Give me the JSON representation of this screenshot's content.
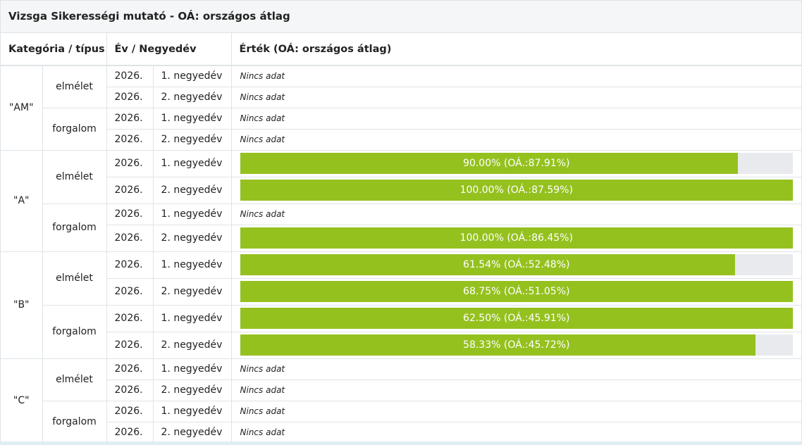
{
  "panel": {
    "title": "Vizsga Sikerességi mutató - OÁ: országos átlag"
  },
  "table": {
    "headers": {
      "category": "Kategória / típus",
      "period": "Év / Negyedév",
      "value": "Érték (OÁ: országos átlag)"
    },
    "no_data": "Nincs adat",
    "categories": [
      {
        "name": "\"AM\"",
        "types": [
          {
            "name": "elmélet",
            "rows": [
              {
                "year": "2026.",
                "quarter": "1. negyedév",
                "text": "Nincs adat",
                "has_bar": false
              },
              {
                "year": "2026.",
                "quarter": "2. negyedév",
                "text": "Nincs adat",
                "has_bar": false
              }
            ]
          },
          {
            "name": "forgalom",
            "rows": [
              {
                "year": "2026.",
                "quarter": "1. negyedév",
                "text": "Nincs adat",
                "has_bar": false
              },
              {
                "year": "2026.",
                "quarter": "2. negyedév",
                "text": "Nincs adat",
                "has_bar": false
              }
            ]
          }
        ]
      },
      {
        "name": "\"A\"",
        "types": [
          {
            "name": "elmélet",
            "rows": [
              {
                "year": "2026.",
                "quarter": "1. negyedév",
                "text": "90.00% (OÁ.:87.91%)",
                "has_bar": true,
                "value": 90.0
              },
              {
                "year": "2026.",
                "quarter": "2. negyedév",
                "text": "100.00% (OÁ.:87.59%)",
                "has_bar": true,
                "value": 100.0
              }
            ]
          },
          {
            "name": "forgalom",
            "rows": [
              {
                "year": "2026.",
                "quarter": "1. negyedév",
                "text": "Nincs adat",
                "has_bar": false
              },
              {
                "year": "2026.",
                "quarter": "2. negyedév",
                "text": "100.00% (OÁ.:86.45%)",
                "has_bar": true,
                "value": 100.0
              }
            ]
          }
        ]
      },
      {
        "name": "\"B\"",
        "types": [
          {
            "name": "elmélet",
            "rows": [
              {
                "year": "2026.",
                "quarter": "1. negyedév",
                "text": "61.54% (OÁ.:52.48%)",
                "has_bar": true,
                "value": 89.5
              },
              {
                "year": "2026.",
                "quarter": "2. negyedév",
                "text": "68.75% (OÁ.:51.05%)",
                "has_bar": true,
                "value": 100.0
              }
            ]
          },
          {
            "name": "forgalom",
            "rows": [
              {
                "year": "2026.",
                "quarter": "1. negyedév",
                "text": "62.50% (OÁ.:45.91%)",
                "has_bar": true,
                "value": 100.0
              },
              {
                "year": "2026.",
                "quarter": "2. negyedév",
                "text": "58.33% (OÁ.:45.72%)",
                "has_bar": true,
                "value": 93.3
              }
            ]
          }
        ]
      },
      {
        "name": "\"C\"",
        "types": [
          {
            "name": "elmélet",
            "rows": [
              {
                "year": "2026.",
                "quarter": "1. negyedév",
                "text": "Nincs adat",
                "has_bar": false
              },
              {
                "year": "2026.",
                "quarter": "2. negyedév",
                "text": "Nincs adat",
                "has_bar": false
              }
            ]
          },
          {
            "name": "forgalom",
            "rows": [
              {
                "year": "2026.",
                "quarter": "1. negyedév",
                "text": "Nincs adat",
                "has_bar": false
              },
              {
                "year": "2026.",
                "quarter": "2. negyedév",
                "text": "Nincs adat",
                "has_bar": false
              }
            ]
          }
        ]
      }
    ]
  },
  "colors": {
    "bar_fill": "#95c11f",
    "bar_track": "#e8eaed",
    "border": "#dfe3e6"
  }
}
